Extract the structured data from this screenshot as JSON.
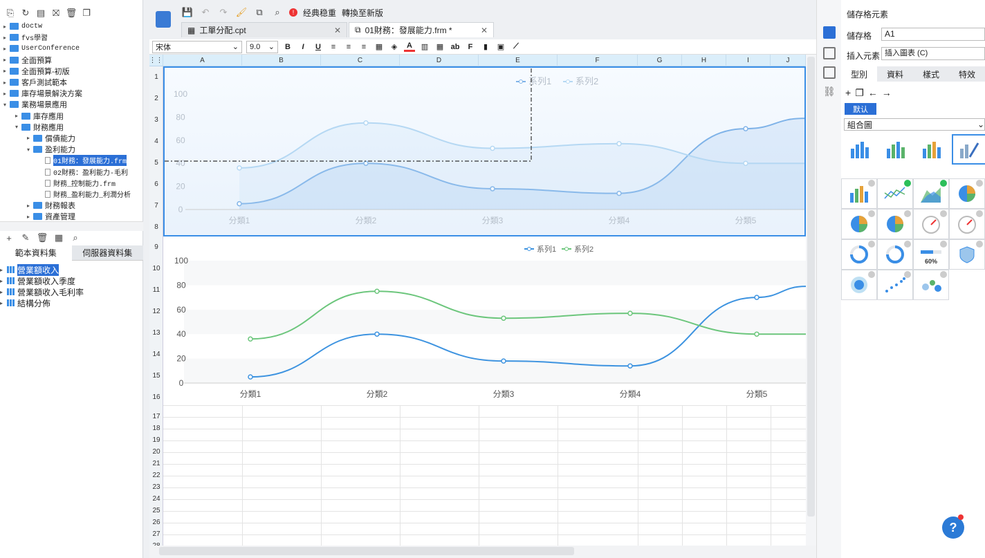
{
  "left_panel": {
    "tree": [
      {
        "label": "doctw",
        "depth": 0,
        "type": "folder",
        "arrow": "▸",
        "mono": true
      },
      {
        "label": "fvs學習",
        "depth": 0,
        "type": "folder",
        "arrow": "▸",
        "mono": true
      },
      {
        "label": "UserConference",
        "depth": 0,
        "type": "folder",
        "arrow": "▸",
        "mono": true
      },
      {
        "label": "全面預算",
        "depth": 0,
        "type": "folder",
        "arrow": "▸"
      },
      {
        "label": "全面預算-初版",
        "depth": 0,
        "type": "folder",
        "arrow": "▸"
      },
      {
        "label": "客戶測試範本",
        "depth": 0,
        "type": "folder",
        "arrow": "▸"
      },
      {
        "label": "庫存場景解決方案",
        "depth": 0,
        "type": "folder",
        "arrow": "▸"
      },
      {
        "label": "業務場景應用",
        "depth": 0,
        "type": "folder",
        "arrow": "▾"
      },
      {
        "label": "庫存應用",
        "depth": 1,
        "type": "folder",
        "arrow": "▸"
      },
      {
        "label": "財務應用",
        "depth": 1,
        "type": "folder",
        "arrow": "▾"
      },
      {
        "label": "償債能力",
        "depth": 2,
        "type": "folder",
        "arrow": "▸"
      },
      {
        "label": "盈利能力",
        "depth": 2,
        "type": "folder",
        "arrow": "▾"
      },
      {
        "label": "01財務：發展能力.frm",
        "depth": 3,
        "type": "file",
        "arrow": "",
        "selected": true
      },
      {
        "label": "02財務：盈利能力-毛利",
        "depth": 3,
        "type": "file",
        "arrow": ""
      },
      {
        "label": "財務_控制能力.frm",
        "depth": 3,
        "type": "file",
        "arrow": ""
      },
      {
        "label": "財務_盈利能力_利潤分析",
        "depth": 3,
        "type": "file",
        "arrow": ""
      },
      {
        "label": "財務報表",
        "depth": 2,
        "type": "folder",
        "arrow": "▸"
      },
      {
        "label": "資產管理",
        "depth": 2,
        "type": "folder",
        "arrow": "▸"
      }
    ],
    "ds_tabs": [
      "範本資料集",
      "伺服器資料集"
    ],
    "datasets": [
      "營業額收入",
      "營業額收入季度",
      "營業額收入毛利率",
      "結構分佈"
    ]
  },
  "top_toolbar": {
    "classic_label": "经典稳重",
    "convert_label": "轉換至新版"
  },
  "file_tabs": [
    {
      "label": "工單分配.cpt",
      "active": false
    },
    {
      "label": "01財務：發展能力.frm *",
      "active": true
    }
  ],
  "format_bar": {
    "font": "宋体",
    "size": "9.0"
  },
  "columns": [
    "A",
    "B",
    "C",
    "D",
    "E",
    "F",
    "G",
    "H",
    "I",
    "J"
  ],
  "rows": [
    "1",
    "2",
    "3",
    "4",
    "5",
    "6",
    "7",
    "8",
    "9",
    "10",
    "11",
    "12",
    "13",
    "14",
    "15",
    "16",
    "17",
    "18",
    "19",
    "20",
    "21",
    "22",
    "23",
    "24",
    "25",
    "26",
    "27",
    "28"
  ],
  "chart_data": [
    {
      "type": "area",
      "categories": [
        "分類1",
        "分類2",
        "分類3",
        "分類4",
        "分類5"
      ],
      "series": [
        {
          "name": "系列1",
          "values": [
            5,
            40,
            18,
            14,
            70
          ],
          "color": "#7fb3e8"
        },
        {
          "name": "系列2",
          "values": [
            36,
            75,
            53,
            57,
            40
          ],
          "color": "#b5d8f3"
        }
      ],
      "yticks": [
        "0",
        "20",
        "40",
        "60",
        "80",
        "100"
      ],
      "ylim": [
        0,
        100
      ],
      "legend": "top-center",
      "smooth": true
    },
    {
      "type": "line",
      "categories": [
        "分類1",
        "分類2",
        "分類3",
        "分類4",
        "分類5"
      ],
      "series": [
        {
          "name": "系列1",
          "values": [
            5,
            40,
            18,
            14,
            70
          ],
          "color": "#3d93e0"
        },
        {
          "name": "系列2",
          "values": [
            36,
            75,
            53,
            57,
            40
          ],
          "color": "#6cc67c"
        }
      ],
      "yticks": [
        "0",
        "20",
        "40",
        "60",
        "80",
        "100"
      ],
      "ylim": [
        0,
        100
      ],
      "legend": "top-center",
      "smooth": true
    }
  ],
  "right_panel": {
    "title": "儲存格元素",
    "cell_label": "儲存格",
    "cell_value": "A1",
    "insert_label": "插入元素",
    "insert_value": "插入圖表 (C)",
    "tabs": [
      "型別",
      "資料",
      "樣式",
      "特效"
    ],
    "default_label": "默认",
    "combo_value": "組合圖",
    "gauge_text": "60%"
  },
  "help": "?"
}
